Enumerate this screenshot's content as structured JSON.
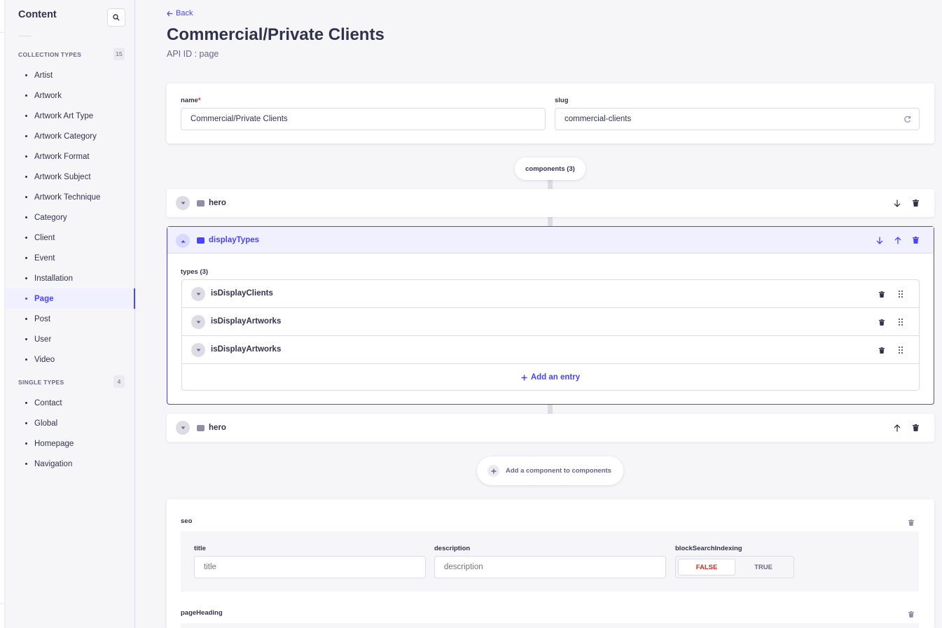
{
  "sidebar": {
    "title": "Content",
    "collection_types": {
      "heading": "COLLECTION TYPES",
      "count": "15",
      "items": [
        "Artist",
        "Artwork",
        "Artwork Art Type",
        "Artwork Category",
        "Artwork Format",
        "Artwork Subject",
        "Artwork Technique",
        "Category",
        "Client",
        "Event",
        "Installation",
        "Page",
        "Post",
        "User",
        "Video"
      ],
      "active": "Page"
    },
    "single_types": {
      "heading": "SINGLE TYPES",
      "count": "4",
      "items": [
        "Contact",
        "Global",
        "Homepage",
        "Navigation"
      ]
    }
  },
  "header": {
    "back_label": "Back",
    "title": "Commercial/Private Clients",
    "api_id": "API ID : page"
  },
  "fields": {
    "name_label": "name",
    "name_required": "*",
    "name_value": "Commercial/Private Clients",
    "slug_label": "slug",
    "slug_value": "commercial-clients"
  },
  "components": {
    "label": "components (3)",
    "items": [
      {
        "name": "hero"
      },
      {
        "name": "displayTypes"
      },
      {
        "name": "hero"
      }
    ],
    "types_label": "types (3)",
    "types": [
      "isDisplayClients",
      "isDisplayArtworks",
      "isDisplayArtworks"
    ],
    "add_entry_label": "Add an entry",
    "add_component_label": "Add a component to components"
  },
  "seo": {
    "label": "seo",
    "title_label": "title",
    "title_placeholder": "title",
    "description_label": "description",
    "description_placeholder": "description",
    "block_label": "blockSearchIndexing",
    "false_label": "FALSE",
    "true_label": "TRUE",
    "page_heading_label": "pageHeading"
  },
  "colors": {
    "primary": "#4945ff",
    "danger": "#d02b20",
    "text": "#32324d",
    "muted": "#666687"
  }
}
